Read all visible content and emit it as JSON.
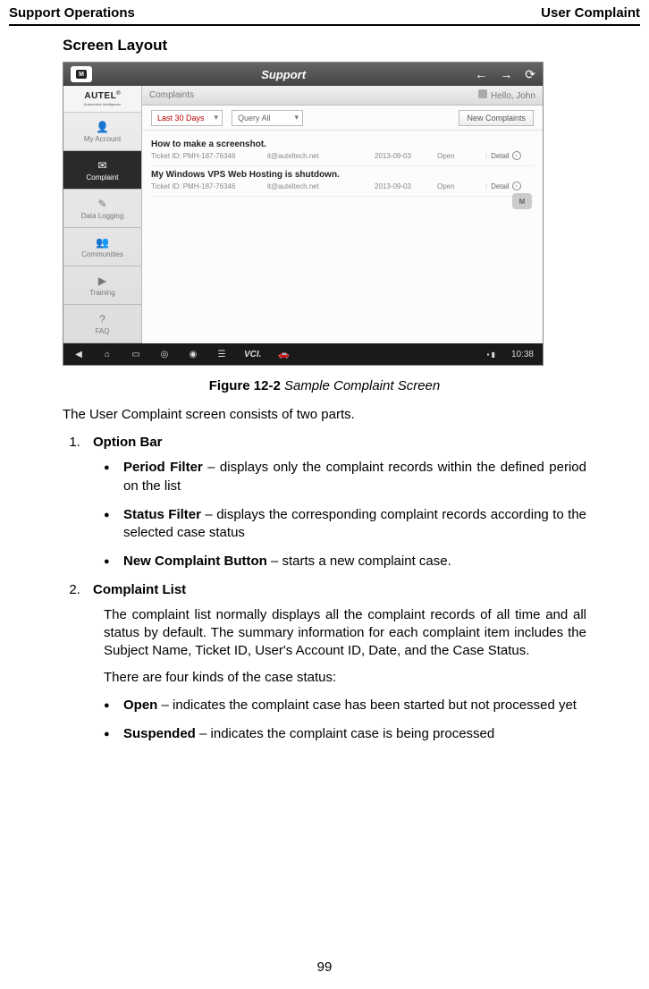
{
  "header": {
    "left": "Support Operations",
    "right": "User Complaint"
  },
  "section_heading": "Screen Layout",
  "screenshot": {
    "top": {
      "title": "Support",
      "back": "←",
      "fwd": "→",
      "refresh": "⟳",
      "home_letter": "M"
    },
    "sidebar": {
      "brand": "AUTEL",
      "reg": "®",
      "tagline": "Automotive Intelligence",
      "items": [
        {
          "label": "My Account",
          "icon": "👤"
        },
        {
          "label": "Complaint",
          "icon": "✉",
          "active": true
        },
        {
          "label": "Data Logging",
          "icon": "✎"
        },
        {
          "label": "Communities",
          "icon": "👥"
        },
        {
          "label": "Training",
          "icon": "▶"
        },
        {
          "label": "FAQ",
          "icon": "?"
        }
      ]
    },
    "tabbar": {
      "title": "Complaints",
      "greeting": "Hello, John"
    },
    "optionbar": {
      "period": "Last 30 Days",
      "status": "Query All",
      "new_btn": "New Complaints"
    },
    "rows": [
      {
        "title": "How to make a screenshot.",
        "ticket_label": "Ticket ID:",
        "ticket": "PMH-187-76346",
        "email": "it@auteltech.net",
        "date": "2013-09-03",
        "status": "Open",
        "detail": "Detail"
      },
      {
        "title": "My Windows VPS Web Hosting is shutdown.",
        "ticket_label": "Ticket ID:",
        "ticket": "PMH-187-76346",
        "email": "it@auteltech.net",
        "date": "2013-09-03",
        "status": "Open",
        "detail": "Detail"
      }
    ],
    "float_badge": "M",
    "bottombar": {
      "icons": [
        "◀",
        "⌂",
        "▭",
        "◎",
        "◉",
        "☰",
        "VCI.",
        "🚗"
      ],
      "time": "10:38"
    }
  },
  "figure": {
    "label": "Figure 12-2",
    "caption": "Sample Complaint Screen"
  },
  "intro": "The User Complaint screen consists of two parts.",
  "list": {
    "item1": {
      "title": "Option Bar",
      "b1_bold": "Period Filter",
      "b1_rest": " – displays only the complaint records within the defined period on the list",
      "b2_bold": "Status Filter",
      "b2_rest": " – displays the corresponding complaint records according to the selected case status",
      "b3_bold": "New Complaint Button",
      "b3_rest": " – starts a new complaint case."
    },
    "item2": {
      "title": "Complaint List",
      "p1": "The complaint list normally displays all the complaint records of all time and all status by default. The summary information for each complaint item includes the Subject Name, Ticket ID, User's Account ID, Date, and the Case Status.",
      "p2": "There are four kinds of the case status:",
      "b1_bold": "Open",
      "b1_rest": " – indicates the complaint case has been started but not processed yet",
      "b2_bold": "Suspended",
      "b2_rest": " – indicates the complaint case is being processed"
    }
  },
  "page_number": "99"
}
